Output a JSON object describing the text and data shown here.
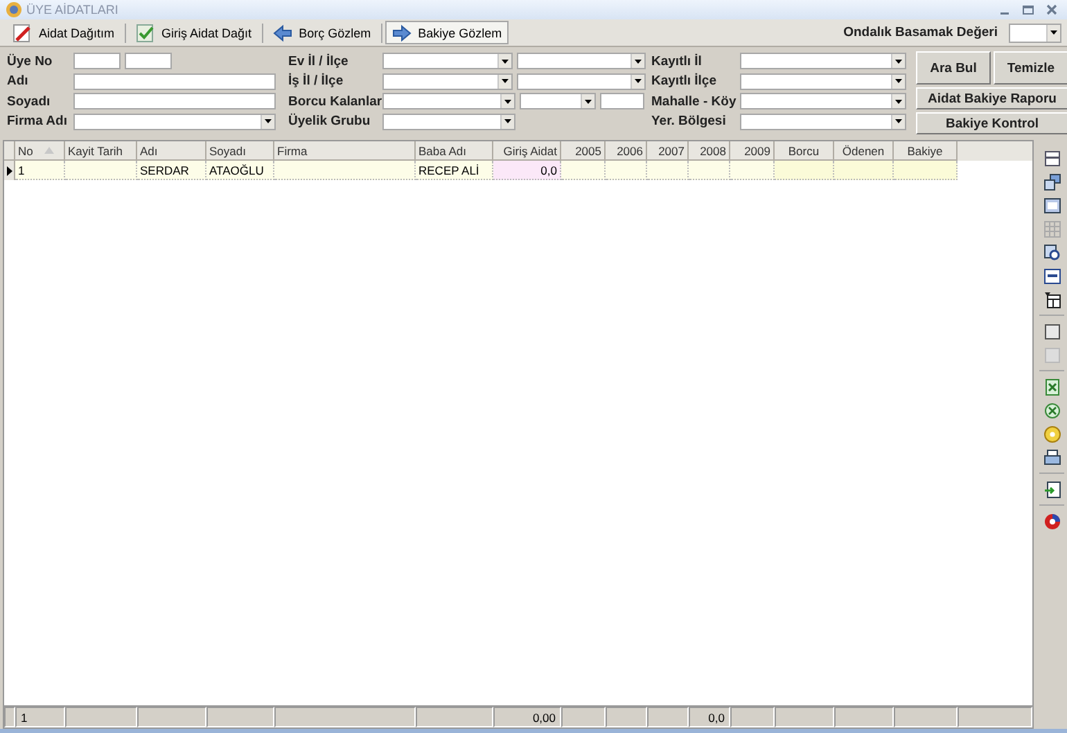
{
  "window": {
    "title": "ÜYE AİDATLARI"
  },
  "tabs": [
    {
      "label": "Aidat Dağıtım",
      "selected": false
    },
    {
      "label": "Giriş Aidat Dağıt",
      "selected": false
    },
    {
      "label": "Borç Gözlem",
      "selected": false
    },
    {
      "label": "Bakiye Gözlem",
      "selected": true
    }
  ],
  "decimal_places": {
    "label": "Ondalık Basamak Değeri"
  },
  "filters": {
    "columns": [
      [
        {
          "label": "Üye No",
          "fields": [
            {
              "kind": "short"
            },
            {
              "kind": "short"
            }
          ]
        },
        {
          "label": "Adı",
          "fields": [
            {
              "kind": "wide"
            }
          ]
        },
        {
          "label": "Soyadı",
          "fields": [
            {
              "kind": "wide"
            }
          ]
        },
        {
          "label": "Firma Adı",
          "fields": [
            {
              "kind": "combo"
            }
          ]
        }
      ],
      [
        {
          "label": "Ev İl / İlçe",
          "fields": [
            {
              "kind": "combo"
            },
            {
              "kind": "combo"
            }
          ]
        },
        {
          "label": "İş İl / İlçe",
          "fields": [
            {
              "kind": "combo"
            },
            {
              "kind": "combo"
            }
          ]
        },
        {
          "label": "Borcu Kalanlar",
          "fields": [
            {
              "kind": "combo"
            },
            {
              "kind": "smallcombo"
            },
            {
              "kind": "short"
            }
          ]
        },
        {
          "label": "Üyelik Grubu",
          "fields": [
            {
              "kind": "combo"
            }
          ]
        }
      ],
      [
        {
          "label": "Kayıtlı İl",
          "fields": [
            {
              "kind": "combo"
            }
          ]
        },
        {
          "label": "Kayıtlı  İlçe",
          "fields": [
            {
              "kind": "combo"
            }
          ]
        },
        {
          "label": "Mahalle - Köy",
          "fields": [
            {
              "kind": "combo"
            }
          ]
        },
        {
          "label": "Yer. Bölgesi",
          "fields": [
            {
              "kind": "combo"
            }
          ]
        }
      ]
    ]
  },
  "buttons": [
    {
      "label": "Ara Bul",
      "kind": "tall"
    },
    {
      "label": "Temizle",
      "kind": "tall"
    },
    {
      "label": "Aidat Bakiye Raporu",
      "kind": "wide"
    },
    {
      "label": "Bakiye Kontrol",
      "kind": "wide"
    }
  ],
  "table": {
    "columns": [
      {
        "label": "No",
        "sorted": true
      },
      {
        "label": "Kayit Tarih",
        "sorted": false
      },
      {
        "label": "Adı",
        "sorted": false
      },
      {
        "label": "Soyadı",
        "sorted": false
      },
      {
        "label": "Firma",
        "sorted": false
      },
      {
        "label": "Baba Adı",
        "sorted": false
      },
      {
        "label": "Giriş Aidat",
        "sorted": false
      },
      {
        "label": "2005",
        "sorted": false
      },
      {
        "label": "2006",
        "sorted": false
      },
      {
        "label": "2007",
        "sorted": false
      },
      {
        "label": "2008",
        "sorted": false
      },
      {
        "label": "2009",
        "sorted": false
      },
      {
        "label": "Borcu",
        "sorted": false
      },
      {
        "label": "Ödenen",
        "sorted": false
      },
      {
        "label": "Bakiye",
        "sorted": false
      }
    ],
    "rows": [
      {
        "selected": true,
        "cells": {
          "column_1": "1",
          "column_3": "SERDAR",
          "column_4": "ATAOĞLU",
          "column_6": "RECEP ALİ",
          "column_7": "0,0"
        }
      }
    ],
    "footer": {
      "column_1": "1",
      "column_7": "0,00",
      "column_11": "0,0"
    }
  }
}
